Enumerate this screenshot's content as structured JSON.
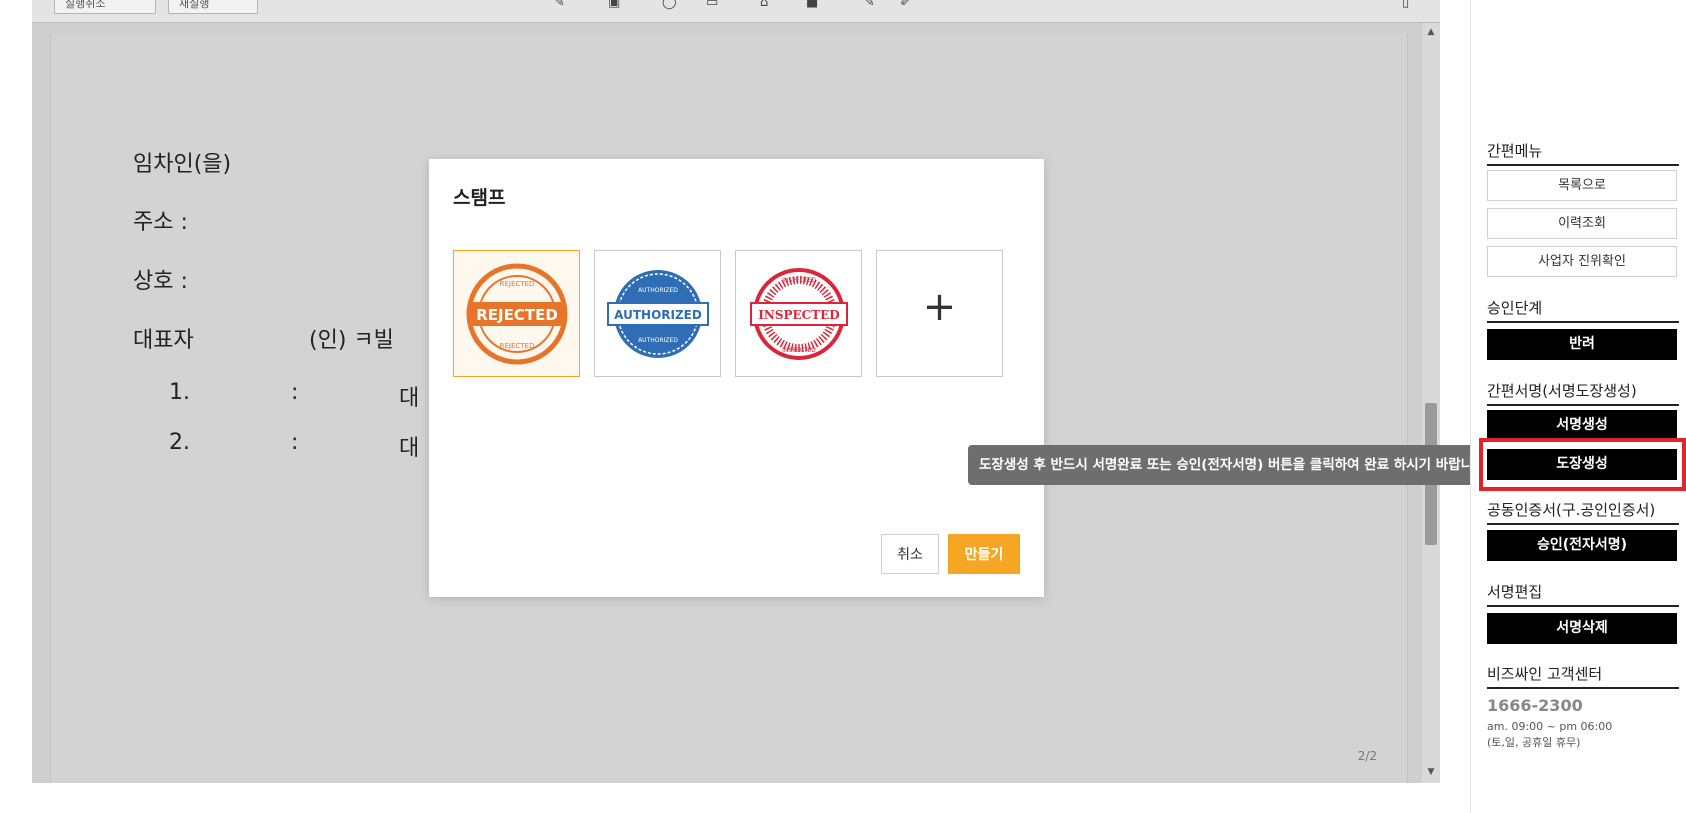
{
  "toolbar": {
    "undo_label": "실행취소",
    "redo_label": "재실행",
    "icons": [
      "pen-icon",
      "text-icon",
      "comment-icon",
      "stamp-icon",
      "signature-icon",
      "font-icon",
      "attach-icon",
      "eraser-icon",
      "panel-icon"
    ]
  },
  "document": {
    "lines": [
      "임차인(을)",
      "주소 :",
      "상호 :",
      "대표자"
    ],
    "sign_text": "(인) ㅋ빌",
    "list": [
      {
        "num": "1.",
        "sep": ":",
        "tail": "대"
      },
      {
        "num": "2.",
        "sep": ":",
        "tail": "대"
      }
    ],
    "page_indicator": "2/2"
  },
  "modal": {
    "title": "스탬프",
    "stamps": [
      {
        "name": "REJECTED",
        "ring": "REJECTED",
        "color": "#e8742a",
        "selected": true
      },
      {
        "name": "AUTHORIZED",
        "ring": "AUTHORIZED",
        "color": "#2f6db5",
        "selected": false
      },
      {
        "name": "INSPECTED",
        "ring": "INSPECTED",
        "color": "#d9263a",
        "selected": false
      }
    ],
    "add_symbol": "+",
    "cancel_label": "취소",
    "create_label": "만들기"
  },
  "tooltip": {
    "text": "도장생성 후 반드시 서명완료 또는 승인(전자서명) 버튼을 클릭하여 완료 하시기 바랍니다."
  },
  "sidebar": {
    "quick_menu": {
      "title": "간편메뉴",
      "items": [
        "목록으로",
        "이력조회",
        "사업자 진위확인"
      ]
    },
    "approval": {
      "title": "승인단계",
      "button": "반려"
    },
    "easy_sign": {
      "title": "간편서명(서명도장생성)",
      "sign_button": "서명생성",
      "stamp_button": "도장생성"
    },
    "certificate": {
      "title": "공동인증서(구.공인인증서)",
      "button": "승인(전자서명)"
    },
    "sign_edit": {
      "title": "서명편집",
      "button": "서명삭제"
    },
    "support": {
      "title": "비즈싸인 고객센터",
      "phone": "1666-2300",
      "hours": "am. 09:00 ~ pm 06:00",
      "holiday": "(토,일, 공휴일 휴무)"
    }
  },
  "colors": {
    "accent": "#f5a623",
    "highlight": "#e0242b",
    "tooltip_bg": "#6e6e6e"
  }
}
